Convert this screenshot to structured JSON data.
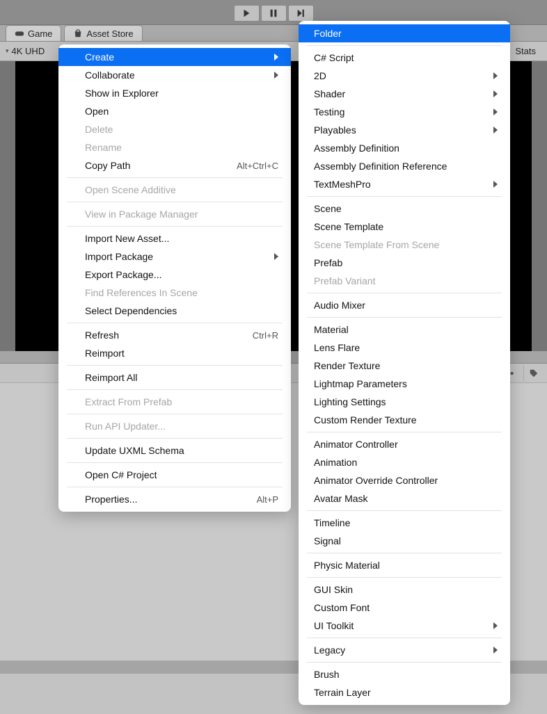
{
  "toolbar": {
    "play": "►",
    "pause": "❚❚",
    "step": "►|"
  },
  "tabs": {
    "game": "Game",
    "assetstore": "Asset Store"
  },
  "subbar": {
    "left": "4K UHD",
    "stats": "Stats"
  },
  "context_primary": {
    "sections": [
      [
        {
          "label": "Create",
          "sub": true,
          "selected": true
        },
        {
          "label": "Collaborate",
          "sub": true
        },
        {
          "label": "Show in Explorer"
        },
        {
          "label": "Open"
        },
        {
          "label": "Delete",
          "disabled": true
        },
        {
          "label": "Rename",
          "disabled": true
        },
        {
          "label": "Copy Path",
          "shortcut": "Alt+Ctrl+C"
        }
      ],
      [
        {
          "label": "Open Scene Additive",
          "disabled": true
        }
      ],
      [
        {
          "label": "View in Package Manager",
          "disabled": true
        }
      ],
      [
        {
          "label": "Import New Asset..."
        },
        {
          "label": "Import Package",
          "sub": true
        },
        {
          "label": "Export Package..."
        },
        {
          "label": "Find References In Scene",
          "disabled": true
        },
        {
          "label": "Select Dependencies"
        }
      ],
      [
        {
          "label": "Refresh",
          "shortcut": "Ctrl+R"
        },
        {
          "label": "Reimport"
        }
      ],
      [
        {
          "label": "Reimport All"
        }
      ],
      [
        {
          "label": "Extract From Prefab",
          "disabled": true
        }
      ],
      [
        {
          "label": "Run API Updater...",
          "disabled": true
        }
      ],
      [
        {
          "label": "Update UXML Schema"
        }
      ],
      [
        {
          "label": "Open C# Project"
        }
      ],
      [
        {
          "label": "Properties...",
          "shortcut": "Alt+P"
        }
      ]
    ]
  },
  "context_create": {
    "sections": [
      [
        {
          "label": "Folder",
          "selected": true
        }
      ],
      [
        {
          "label": "C# Script"
        },
        {
          "label": "2D",
          "sub": true
        },
        {
          "label": "Shader",
          "sub": true
        },
        {
          "label": "Testing",
          "sub": true
        },
        {
          "label": "Playables",
          "sub": true
        },
        {
          "label": "Assembly Definition"
        },
        {
          "label": "Assembly Definition Reference"
        },
        {
          "label": "TextMeshPro",
          "sub": true
        }
      ],
      [
        {
          "label": "Scene"
        },
        {
          "label": "Scene Template"
        },
        {
          "label": "Scene Template From Scene",
          "disabled": true
        },
        {
          "label": "Prefab"
        },
        {
          "label": "Prefab Variant",
          "disabled": true
        }
      ],
      [
        {
          "label": "Audio Mixer"
        }
      ],
      [
        {
          "label": "Material"
        },
        {
          "label": "Lens Flare"
        },
        {
          "label": "Render Texture"
        },
        {
          "label": "Lightmap Parameters"
        },
        {
          "label": "Lighting Settings"
        },
        {
          "label": "Custom Render Texture"
        }
      ],
      [
        {
          "label": "Animator Controller"
        },
        {
          "label": "Animation"
        },
        {
          "label": "Animator Override Controller"
        },
        {
          "label": "Avatar Mask"
        }
      ],
      [
        {
          "label": "Timeline"
        },
        {
          "label": "Signal"
        }
      ],
      [
        {
          "label": "Physic Material"
        }
      ],
      [
        {
          "label": "GUI Skin"
        },
        {
          "label": "Custom Font"
        },
        {
          "label": "UI Toolkit",
          "sub": true
        }
      ],
      [
        {
          "label": "Legacy",
          "sub": true
        }
      ],
      [
        {
          "label": "Brush"
        },
        {
          "label": "Terrain Layer"
        }
      ]
    ]
  }
}
